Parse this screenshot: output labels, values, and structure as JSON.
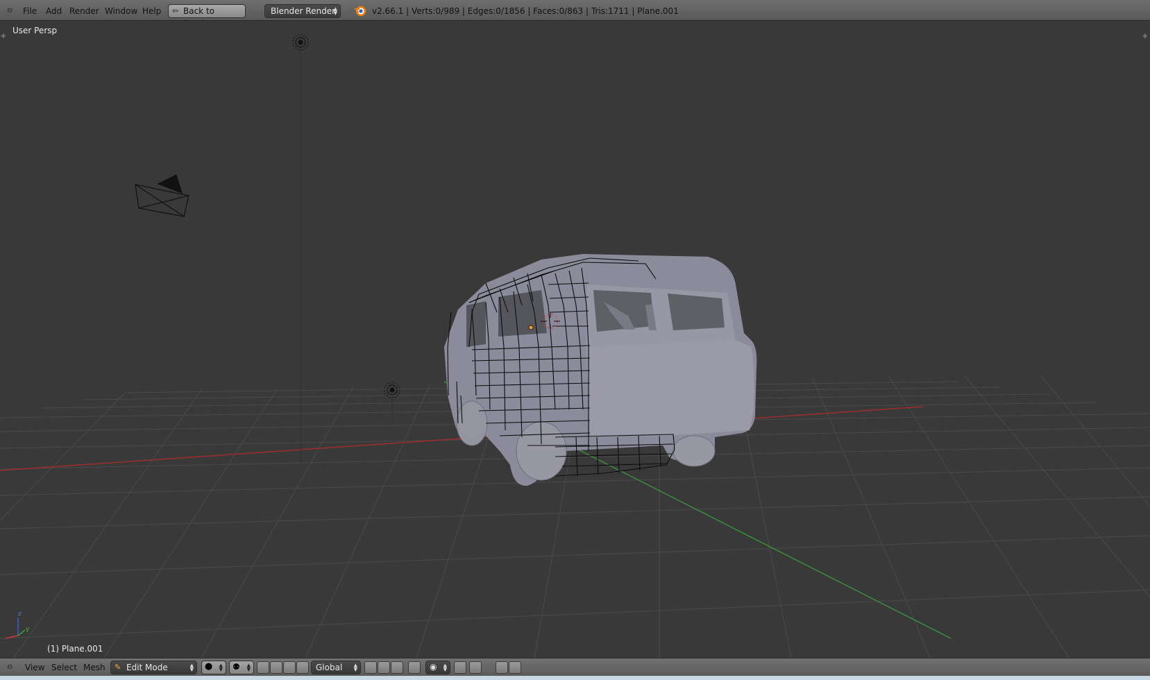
{
  "menu": {
    "file": "File",
    "add": "Add",
    "render": "Render",
    "window": "Window",
    "help": "Help"
  },
  "back_button": "Back to Previous",
  "render_engine": "Blender Render",
  "status": "v2.66.1 | Verts:0/989 | Edges:0/1856 | Faces:0/863 | Tris:1711 | Plane.001",
  "viewport": {
    "view_name": "User Persp",
    "object_label": "(1) Plane.001",
    "axis_z": "z",
    "axis_y": "y"
  },
  "bottom": {
    "view": "View",
    "select": "Select",
    "mesh": "Mesh",
    "mode": "Edit Mode",
    "orientation": "Global"
  },
  "colors": {
    "viewport_bg": "#393939",
    "x_axis": "#b03030",
    "y_axis": "#3f9f3f",
    "mesh_body": "#8e8e9e"
  }
}
